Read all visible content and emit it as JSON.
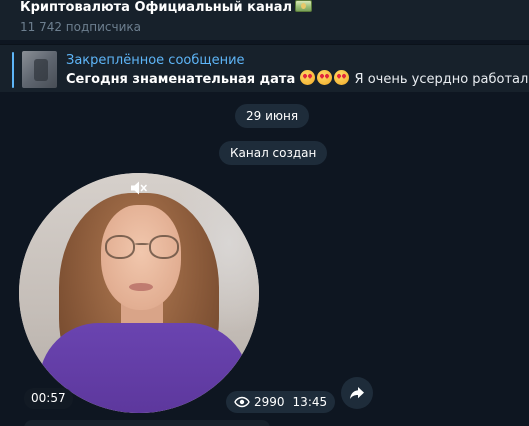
{
  "header": {
    "title": "Криптовалюта Официальный канал",
    "title_icon": "money-bag-icon",
    "subscribers": "11 742 подписчика"
  },
  "pinned": {
    "label": "Закреплённое сообщение",
    "text_bold": "Сегодня знаменательная дата",
    "emoji": [
      "smiling-face-with-heart-eyes",
      "smiling-face-with-heart-eyes",
      "smiling-face-with-heart-eyes"
    ],
    "text_rest": "Я очень усердно работала и ста"
  },
  "chat": {
    "date_label": "29 июня",
    "service_message": "Канал создан",
    "video_message": {
      "duration": "00:57",
      "views": "2990",
      "time": "13:45",
      "muted": true
    }
  },
  "colors": {
    "background": "#0e1621",
    "panel": "#17212b",
    "accent": "#5eb5f7",
    "pill": "#1e2c3a"
  }
}
